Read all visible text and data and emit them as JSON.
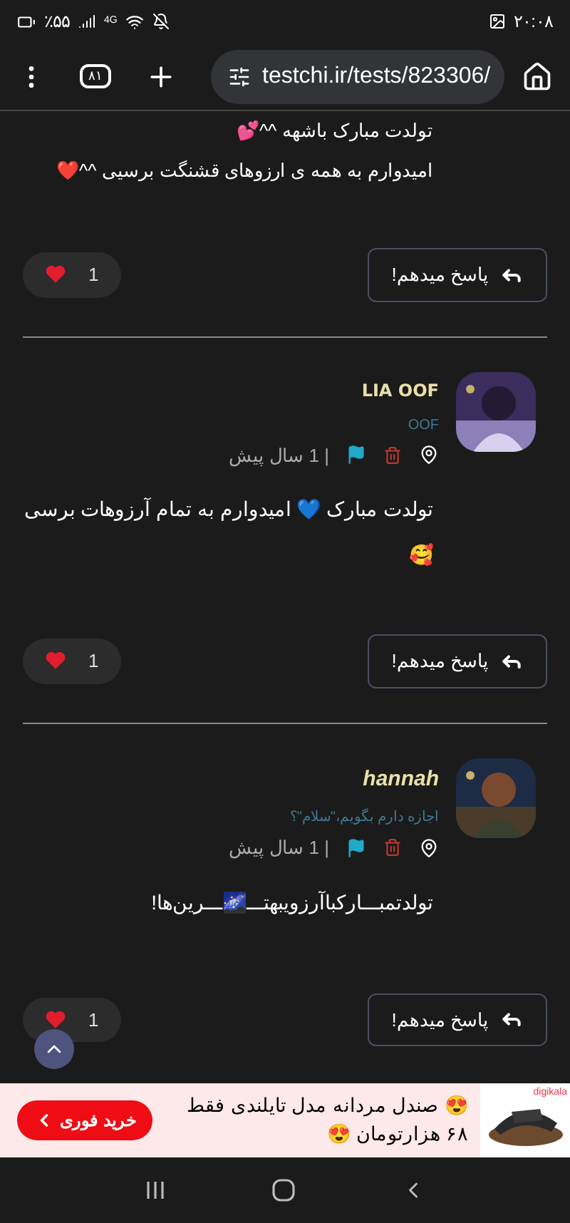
{
  "status_bar": {
    "time": "۲۰:۰۸",
    "battery": "٪۵۵",
    "network": "4G"
  },
  "browser": {
    "url": "testchi.ir/tests/823306/",
    "tab_count": "۸۱"
  },
  "comments": [
    {
      "kind": "partial",
      "lines": [
        "تولدت مبارک باشهه ^^💕",
        "امیدوارم به همه ی ارزوهای قشنگت برسیی ^^❤️"
      ],
      "likes": "1",
      "reply": "پاسخ میدهم!"
    },
    {
      "kind": "full",
      "author": "LIA OOF",
      "author_italic": false,
      "subtitle": "OOF",
      "time": "| 1 سال پیش",
      "lines": [
        "تولدت مبارک 💙 امیدوارم به تمام آرزوهات برسی",
        "🥰"
      ],
      "likes": "1",
      "reply": "پاسخ میدهم!"
    },
    {
      "kind": "full",
      "author": "hannah",
      "author_italic": true,
      "subtitle": "اجازه دارم بگویم،\"سلام\"؟",
      "time": "| 1 سال پیش",
      "lines": [
        "تولدتمبـــارکباآرزویبهتـــ🌌ـــرین‌ها!"
      ],
      "likes": "1",
      "reply": "پاسخ میدهم!"
    }
  ],
  "ad": {
    "brand": "digikala",
    "text": "😍 صندل مردانه مدل تایلندی فقط ۶۸ هزارتومان 😍",
    "button": "خرید فوری"
  }
}
